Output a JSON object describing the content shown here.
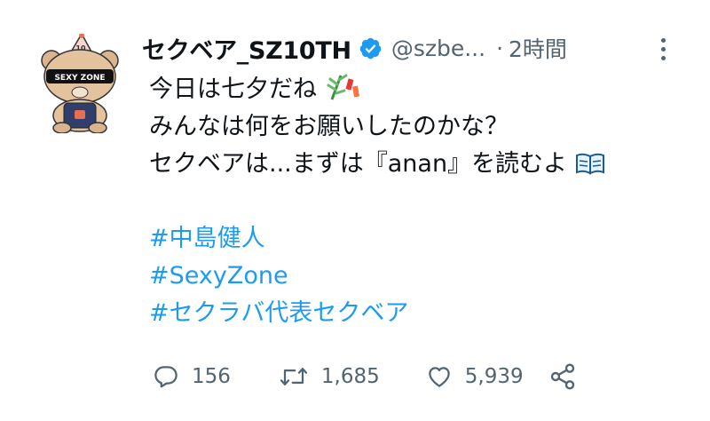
{
  "tweet": {
    "display_name": "セクベア_SZ10TH",
    "handle": "@szbe...",
    "separator": "·",
    "time": "2時間",
    "lines": [
      "今日は七夕だね",
      "みんなは何をお願いしたのかな？",
      "セクベアは...まずは『anan』を読むよ"
    ],
    "hashtags": [
      "#中島健人",
      "#SexyZone",
      "#セクラバ代表セクベア"
    ],
    "emoji_icons": [
      "tanabata-tree-icon",
      "open-book-icon"
    ],
    "avatar_text": "SEXY ZONE",
    "hat_text": "10"
  },
  "actions": {
    "replies": "156",
    "retweets": "1,685",
    "likes": "5,939"
  },
  "colors": {
    "link": "#1d9bf0",
    "secondary": "#536471",
    "verified": "#1d9bf0"
  }
}
